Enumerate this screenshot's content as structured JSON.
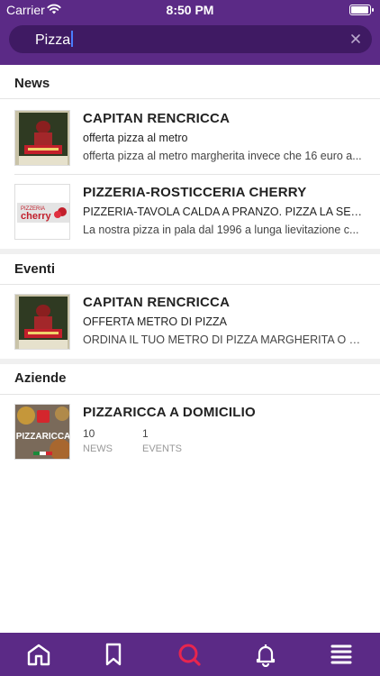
{
  "status_bar": {
    "carrier": "Carrier",
    "time": "8:50 PM"
  },
  "search": {
    "value": "Pizza"
  },
  "sections": {
    "news": {
      "header": "News",
      "items": [
        {
          "title": "CAPITAN RENCRICCA",
          "subtitle": "offerta pizza al metro",
          "description": "offerta pizza al metro margherita invece che 16 euro a..."
        },
        {
          "title": "PIZZERIA-ROSTICCERIA CHERRY",
          "subtitle": "PIZZERIA-TAVOLA CALDA A PRANZO. PIZZA LA SER...",
          "description": "La nostra pizza in pala dal 1996 a lunga lievitazione c...",
          "thumb_text_top": "PIZZERIA",
          "thumb_text_bottom": "cherry"
        }
      ]
    },
    "eventi": {
      "header": "Eventi",
      "items": [
        {
          "title": "CAPITAN RENCRICCA",
          "subtitle": "OFFERTA METRO DI PIZZA",
          "description": "ORDINA IL TUO METRO DI PIZZA MARGHERITA O CO..."
        }
      ]
    },
    "aziende": {
      "header": "Aziende",
      "items": [
        {
          "title": "PIZZARICCA A DOMICILIO",
          "news_count": "10",
          "news_label": "NEWS",
          "events_count": "1",
          "events_label": "EVENTS",
          "thumb_text": "PIZZARICCA"
        }
      ]
    }
  },
  "tab_bar": {
    "icons": [
      "home-icon",
      "bookmark-icon",
      "search-icon",
      "bell-icon",
      "menu-icon"
    ],
    "active": "search-icon"
  },
  "colors": {
    "primary": "#5b2a86",
    "search_bg": "#3f1a63",
    "active_tab": "#e8254e"
  }
}
